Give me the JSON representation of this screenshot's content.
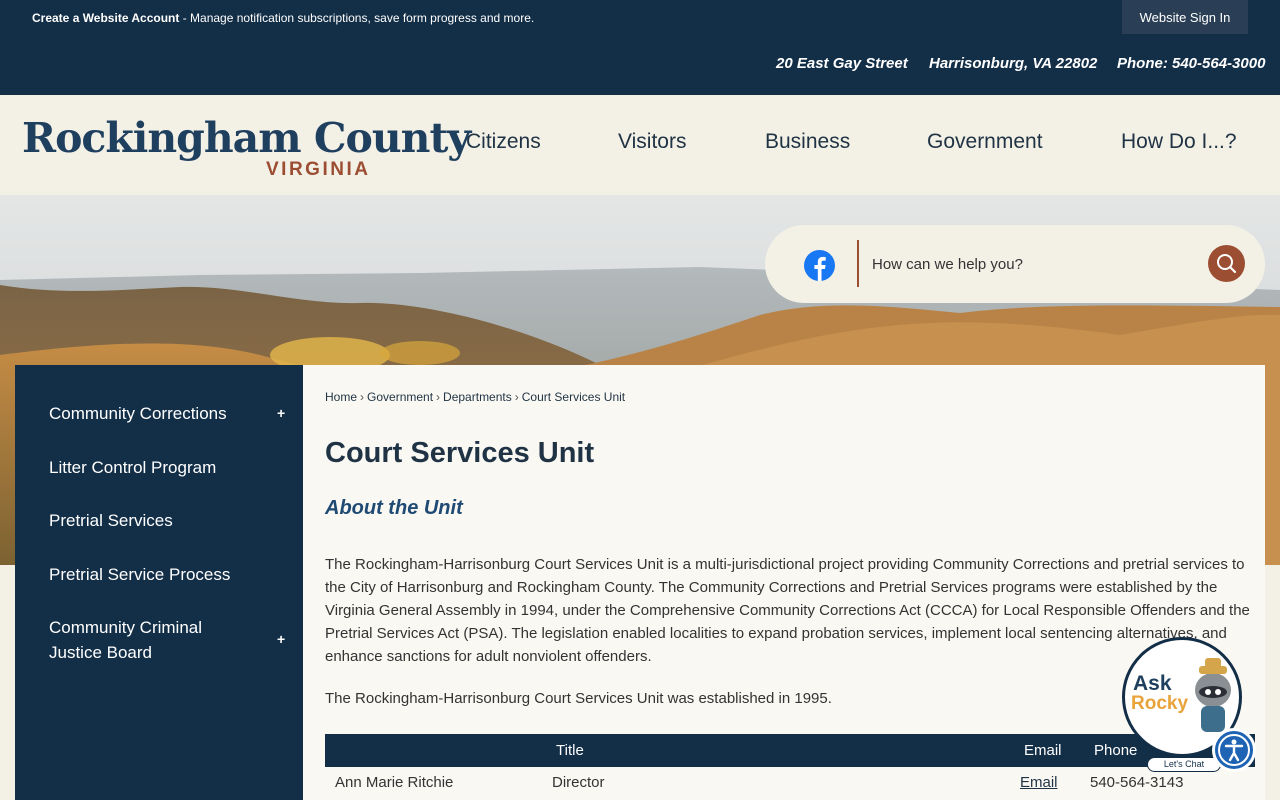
{
  "topbar": {
    "create_account": "Create a Website Account",
    "create_account_desc": " - Manage notification subscriptions, save form progress and more.",
    "sign_in": "Website Sign In"
  },
  "address": {
    "street": "20 East Gay Street",
    "city": "Harrisonburg, VA 22802",
    "phone": "Phone: 540-564-3000"
  },
  "logo": {
    "main": "Rockingham County",
    "sub": "VIRGINIA"
  },
  "nav": [
    "Citizens",
    "Visitors",
    "Business",
    "Government",
    "How Do I...?"
  ],
  "search": {
    "placeholder": "How can we help you?"
  },
  "sidebar": {
    "items": [
      {
        "label": "Community Corrections",
        "expandable": "+"
      },
      {
        "label": "Litter Control Program"
      },
      {
        "label": "Pretrial Services"
      },
      {
        "label": "Pretrial Service Process"
      },
      {
        "label": "Community Criminal Justice Board",
        "expandable": "+"
      }
    ]
  },
  "breadcrumb": [
    "Home",
    "Government",
    "Departments",
    "Court Services Unit"
  ],
  "breadcrumb_sep": "›",
  "page": {
    "title": "Court Services Unit",
    "subtitle": "About the Unit",
    "paragraph1": "The Rockingham-Harrisonburg Court Services Unit is a multi-jurisdictional project providing Community Corrections and pretrial services to the City of Harrisonburg and Rockingham County. The Community Corrections and Pretrial Services programs were established by the Virginia General Assembly in 1994, under the Comprehensive Community Corrections Act (CCCA) for Local Responsible Offenders and the Pretrial Services Act (PSA). The legislation enabled localities to expand probation services, implement local sentencing alternatives, and enhance sanctions for adult nonviolent offenders.",
    "paragraph2": "The Rockingham-Harrisonburg Court Services Unit was established in 1995."
  },
  "table": {
    "headers": {
      "title": "Title",
      "email": "Email",
      "phone": "Phone"
    },
    "rows": [
      {
        "name": "Ann Marie Ritchie",
        "title": "Director",
        "email": "Email",
        "phone": "540-564-3143"
      }
    ]
  },
  "chat": {
    "ask": "Ask",
    "name": "Rocky",
    "cta": "Let's Chat"
  },
  "colors": {
    "navy": "#132e47",
    "cream": "#f3f0e6",
    "rust": "#9c4e32",
    "facebook": "#1877f2"
  }
}
